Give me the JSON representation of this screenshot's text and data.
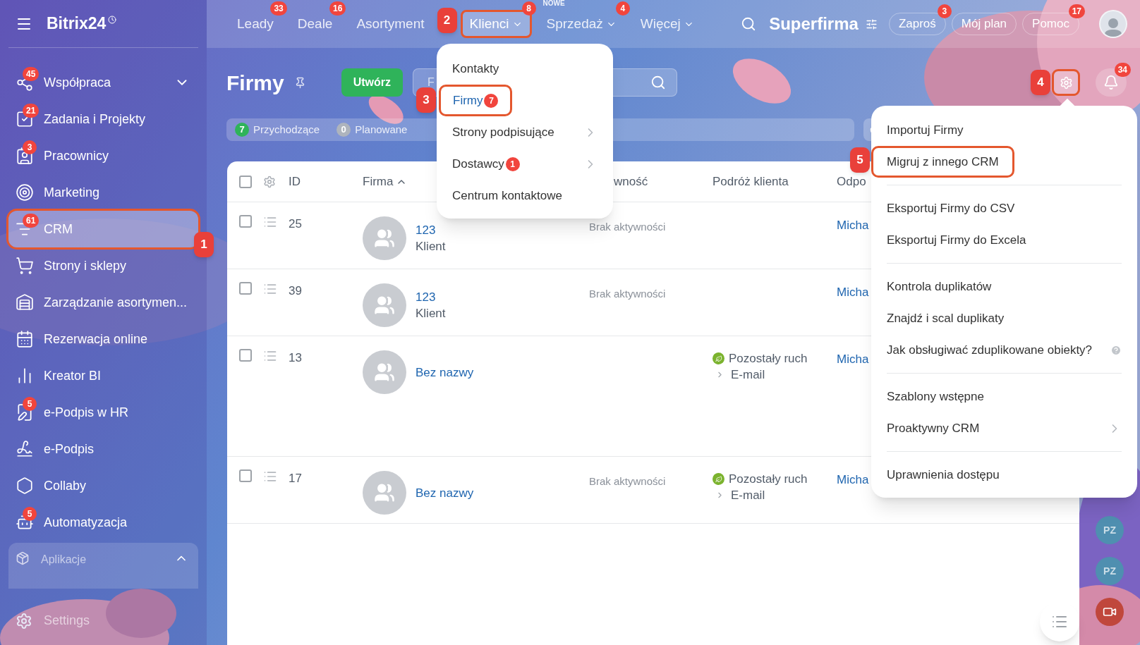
{
  "sidebar": {
    "logo": "Bitrix24",
    "items": [
      {
        "label": "Współpraca",
        "badge": "45",
        "expandable": true,
        "selected": false,
        "highlighted": false
      },
      {
        "label": "Zadania i Projekty",
        "badge": "21",
        "expandable": false,
        "selected": false,
        "highlighted": false
      },
      {
        "label": "Pracownicy",
        "badge": "3",
        "expandable": false,
        "selected": false,
        "highlighted": false
      },
      {
        "label": "Marketing",
        "expandable": false,
        "selected": false,
        "highlighted": false
      },
      {
        "label": "CRM",
        "badge": "61",
        "expandable": false,
        "selected": true,
        "highlighted": true,
        "callout": "1"
      },
      {
        "label": "Strony i sklepy",
        "expandable": false,
        "selected": false,
        "highlighted": false
      },
      {
        "label": "Zarządzanie asortymen...",
        "expandable": false,
        "selected": false,
        "highlighted": false
      },
      {
        "label": "Rezerwacja online",
        "expandable": false,
        "selected": false,
        "highlighted": false
      },
      {
        "label": "Kreator BI",
        "expandable": false,
        "selected": false,
        "highlighted": false
      },
      {
        "label": "e-Podpis w HR",
        "badge": "5",
        "expandable": false,
        "selected": false,
        "highlighted": false
      },
      {
        "label": "e-Podpis",
        "expandable": false,
        "selected": false,
        "highlighted": false
      },
      {
        "label": "Collaby",
        "expandable": false,
        "selected": false,
        "highlighted": false
      },
      {
        "label": "Automatyzacja",
        "badge": "5",
        "expandable": false,
        "selected": false,
        "highlighted": false
      }
    ],
    "group": {
      "label": "Aplikacje",
      "expanded": true
    },
    "settings": "Settings"
  },
  "topbar": {
    "nav": [
      {
        "label": "Leady",
        "badge": "33",
        "dropdown": false,
        "selected": false,
        "highlighted": false
      },
      {
        "label": "Deale",
        "badge": "16",
        "dropdown": false,
        "selected": false,
        "highlighted": false
      },
      {
        "label": "Asortyment",
        "dropdown": false,
        "selected": false,
        "highlighted": false
      },
      {
        "label": "Klienci",
        "badge": "8",
        "dropdown": true,
        "selected": true,
        "highlighted": true,
        "callout": "2"
      },
      {
        "label": "Sprzedaż",
        "badge": "4",
        "tag": "NOWE",
        "dropdown": true,
        "selected": false,
        "highlighted": false
      },
      {
        "label": "Więcej",
        "dropdown": true,
        "selected": false,
        "highlighted": false
      }
    ],
    "company": "Superfirma",
    "buttons": [
      {
        "label": "Zaproś",
        "badge": "3"
      },
      {
        "label": "Mój plan"
      },
      {
        "label": "Pomoc",
        "badge": "17"
      }
    ]
  },
  "page": {
    "title": "Firmy",
    "create": "Utwórz",
    "search_placeholder": "F",
    "settings_highlighted": true,
    "settings_callout": "4",
    "notifications": "34"
  },
  "counters": [
    {
      "count": "7",
      "label": "Przychodzące",
      "color": "#2fb35a"
    },
    {
      "count": "0",
      "label": "Planowane",
      "color": "#aeb4bd"
    }
  ],
  "table": {
    "all_checked": false,
    "columns": [
      {
        "label": "ID",
        "sorted": false
      },
      {
        "label": "Firma",
        "sorted": true
      },
      {
        "label": "wność",
        "sorted": false
      },
      {
        "label": "Podróż klienta",
        "sorted": false
      },
      {
        "label": "Odpo",
        "sorted": false
      }
    ],
    "rows": [
      {
        "id": "25",
        "name": "123",
        "subtitle": "Klient",
        "activity": "Brak aktywności",
        "responsible": "Micha",
        "checked": false
      },
      {
        "id": "39",
        "name": "123",
        "subtitle": "Klient",
        "activity": "Brak aktywności",
        "responsible": "Micha",
        "checked": false
      },
      {
        "id": "13",
        "name": "Bez nazwy",
        "journey": {
          "stage": "Pozostały ruch",
          "channel": "E-mail"
        },
        "responsible": "Micha",
        "checked": false
      },
      {
        "id": "17",
        "name": "Bez nazwy",
        "activity": "Brak aktywności",
        "journey": {
          "stage": "Pozostały ruch",
          "channel": "E-mail"
        },
        "responsible": "Micha",
        "checked": false
      }
    ]
  },
  "right_rail": [
    "PZ",
    "PZ"
  ],
  "clients_menu": [
    {
      "label": "Kontakty",
      "submenu": false,
      "selected": false,
      "highlighted": false
    },
    {
      "label": "Firmy",
      "badge": "7",
      "submenu": false,
      "selected": true,
      "highlighted": true,
      "callout": "3"
    },
    {
      "label": "Strony podpisujące",
      "submenu": true,
      "selected": false,
      "highlighted": false
    },
    {
      "label": "Dostawcy",
      "badge": "1",
      "submenu": true,
      "selected": false,
      "highlighted": false
    },
    {
      "label": "Centrum kontaktowe",
      "submenu": false,
      "selected": false,
      "highlighted": false
    }
  ],
  "settings_menu": [
    [
      {
        "label": "Importuj Firmy",
        "highlighted": false,
        "help": false,
        "submenu": false
      },
      {
        "label": "Migruj z innego CRM",
        "highlighted": true,
        "help": false,
        "submenu": false,
        "callout": "5"
      }
    ],
    [
      {
        "label": "Eksportuj Firmy do CSV",
        "highlighted": false,
        "help": false,
        "submenu": false
      },
      {
        "label": "Eksportuj Firmy do Excela",
        "highlighted": false,
        "help": false,
        "submenu": false
      }
    ],
    [
      {
        "label": "Kontrola duplikatów",
        "highlighted": false,
        "help": false,
        "submenu": false
      },
      {
        "label": "Znajdź i scal duplikaty",
        "highlighted": false,
        "help": false,
        "submenu": false
      },
      {
        "label": "Jak obsługiwać zduplikowane obiekty?",
        "highlighted": false,
        "help": true,
        "submenu": false
      }
    ],
    [
      {
        "label": "Szablony wstępne",
        "highlighted": false,
        "help": false,
        "submenu": false
      },
      {
        "label": "Proaktywny CRM",
        "highlighted": false,
        "help": false,
        "submenu": true
      }
    ],
    [
      {
        "label": "Uprawnienia dostępu",
        "highlighted": false,
        "help": false,
        "submenu": false
      }
    ]
  ]
}
